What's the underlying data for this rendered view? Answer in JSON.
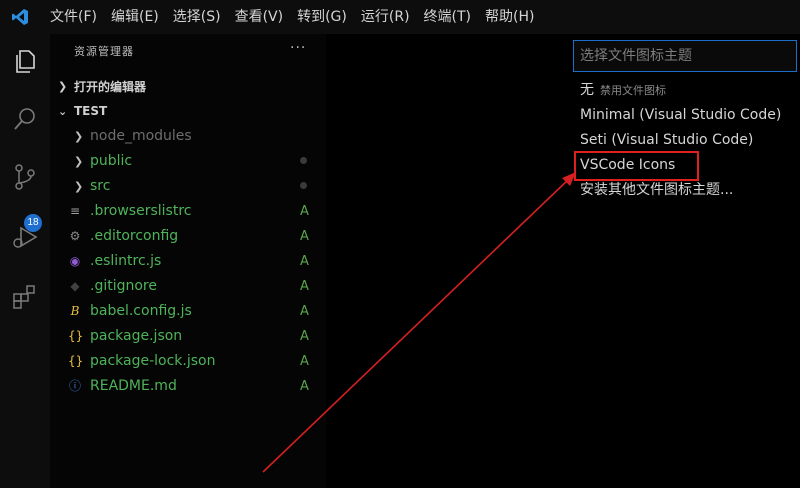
{
  "menu": [
    "文件(F)",
    "编辑(E)",
    "选择(S)",
    "查看(V)",
    "转到(G)",
    "运行(R)",
    "终端(T)",
    "帮助(H)"
  ],
  "activity_bar": {
    "icons": [
      "files-icon",
      "search-icon",
      "source-control-icon",
      "run-debug-icon",
      "extensions-icon"
    ],
    "scm_badge": "18"
  },
  "sidebar": {
    "title": "资源管理器",
    "more": "···",
    "open_editors_label": "打开的编辑器",
    "workspace_label": "TEST",
    "items": [
      {
        "name": "node_modules",
        "type": "folder",
        "status": "",
        "color": "#6e6e6e"
      },
      {
        "name": "public",
        "type": "folder",
        "status": "dot",
        "color": "#4fb35a"
      },
      {
        "name": "src",
        "type": "folder",
        "status": "dot",
        "color": "#4fb35a"
      },
      {
        "name": ".browserslistrc",
        "type": "file",
        "icon": "list-icon",
        "status": "A",
        "color": "#4fb35a"
      },
      {
        "name": ".editorconfig",
        "type": "file",
        "icon": "gear-icon",
        "status": "A",
        "color": "#4fb35a"
      },
      {
        "name": ".eslintrc.js",
        "type": "file",
        "icon": "eslint-icon",
        "status": "A",
        "color": "#4fb35a"
      },
      {
        "name": ".gitignore",
        "type": "file",
        "icon": "git-icon",
        "status": "A",
        "color": "#4fb35a"
      },
      {
        "name": "babel.config.js",
        "type": "file",
        "icon": "babel-icon",
        "status": "A",
        "color": "#4fb35a"
      },
      {
        "name": "package.json",
        "type": "file",
        "icon": "json-icon",
        "status": "A",
        "color": "#4fb35a"
      },
      {
        "name": "package-lock.json",
        "type": "file",
        "icon": "json-icon",
        "status": "A",
        "color": "#4fb35a"
      },
      {
        "name": "README.md",
        "type": "file",
        "icon": "info-icon",
        "status": "A",
        "color": "#4fb35a"
      }
    ]
  },
  "picker": {
    "placeholder": "选择文件图标主题",
    "options": [
      {
        "label": "无",
        "desc": "禁用文件图标"
      },
      {
        "label": "Minimal (Visual Studio Code)",
        "desc": ""
      },
      {
        "label": "Seti (Visual Studio Code)",
        "desc": ""
      },
      {
        "label": "VSCode Icons",
        "desc": ""
      },
      {
        "label": "安装其他文件图标主题...",
        "desc": ""
      }
    ]
  },
  "colors": {
    "accent": "#1a6fc8",
    "highlight": "#e01f1f",
    "added": "#59a64b"
  }
}
